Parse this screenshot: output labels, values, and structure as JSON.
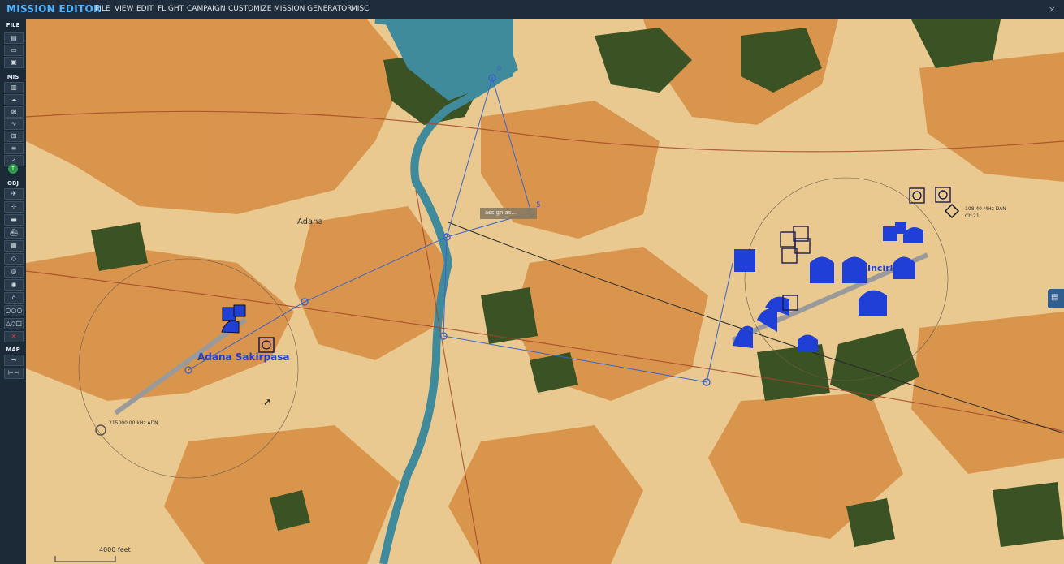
{
  "app": {
    "title": "MISSION EDITOR",
    "close_glyph": "×"
  },
  "menu": [
    "FILE",
    "VIEW",
    "EDIT",
    "FLIGHT",
    "CAMPAIGN",
    "CUSTOMIZE",
    "MISSION GENERATOR",
    "MISC"
  ],
  "sidebar": {
    "sections": [
      "FILE",
      "MIS",
      "OBJ",
      "MAP"
    ],
    "buttons": [
      {
        "section": "file",
        "icon": "new-mission-icon",
        "glyph": "▤"
      },
      {
        "section": "file",
        "icon": "open-mission-icon",
        "glyph": "▭"
      },
      {
        "section": "file",
        "icon": "save-mission-icon",
        "glyph": "▣"
      },
      {
        "section": "mis",
        "icon": "briefing-icon",
        "glyph": "▥"
      },
      {
        "section": "mis",
        "icon": "weather-icon",
        "glyph": "☁"
      },
      {
        "section": "mis",
        "icon": "triggers-icon",
        "glyph": "⊠"
      },
      {
        "section": "mis",
        "icon": "route-icon",
        "glyph": "∿"
      },
      {
        "section": "mis",
        "icon": "goals-icon",
        "glyph": "⊞"
      },
      {
        "section": "mis",
        "icon": "units-list-icon",
        "glyph": "≡"
      },
      {
        "section": "mis",
        "icon": "check-icon",
        "glyph": "✓"
      },
      {
        "section": "obj",
        "icon": "plane-icon",
        "glyph": "✈"
      },
      {
        "section": "obj",
        "icon": "helicopter-icon",
        "glyph": "⊹"
      },
      {
        "section": "obj",
        "icon": "ground-unit-icon",
        "glyph": "▬"
      },
      {
        "section": "obj",
        "icon": "ship-icon",
        "glyph": "⛴"
      },
      {
        "section": "obj",
        "icon": "static-object-icon",
        "glyph": "▦"
      },
      {
        "section": "obj",
        "icon": "waypoint-icon",
        "glyph": "◇"
      },
      {
        "section": "obj",
        "icon": "target-zone-icon",
        "glyph": "◎"
      },
      {
        "section": "obj",
        "icon": "radio-icon",
        "glyph": "◉"
      },
      {
        "section": "obj",
        "icon": "airfield-icon",
        "glyph": "⌂"
      },
      {
        "section": "obj",
        "icon": "group-icon",
        "glyph": "○○○"
      },
      {
        "section": "obj",
        "icon": "shapes-icon",
        "glyph": "△◇□"
      },
      {
        "section": "obj",
        "icon": "delete-icon",
        "glyph": "✕"
      },
      {
        "section": "map",
        "icon": "ruler-icon",
        "glyph": "⊸"
      },
      {
        "section": "map",
        "icon": "measure-icon",
        "glyph": "⊢⊣"
      }
    ]
  },
  "map": {
    "city_label": "Adana",
    "airfields": [
      {
        "name": "Adana Sakirpasa",
        "color": "#1f3fd6"
      },
      {
        "name": "Incirlik",
        "color": "#1f3fd6"
      }
    ],
    "beacons": [
      {
        "label": "215000.00 kHz ADN"
      },
      {
        "label": "108.40 MHz DAN"
      },
      {
        "label": "Ch:21"
      }
    ],
    "waypoint_label": "5",
    "waypoint_label_small": "0",
    "tooltip": "assign as...",
    "scale": {
      "label": "4000 feet"
    },
    "colors": {
      "land_light": "#e9c98f",
      "land_orange": "#d9924a",
      "forest": "#3b5224",
      "water": "#3f8a9b",
      "route": "#3b63c9",
      "unit_blue": "#1f3fd6"
    }
  }
}
